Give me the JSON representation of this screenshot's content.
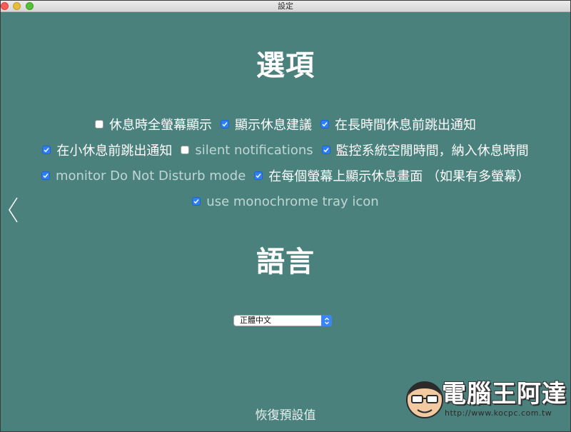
{
  "window": {
    "title": "設定",
    "background_color": "#4a817d"
  },
  "options_section": {
    "title": "選項",
    "rows": [
      [
        {
          "label": "休息時全螢幕顯示",
          "checked": false
        },
        {
          "label": "顯示休息建議",
          "checked": true
        },
        {
          "label": "在長時間休息前跳出通知",
          "checked": true
        }
      ],
      [
        {
          "label": "在小休息前跳出通知",
          "checked": true
        },
        {
          "label": "silent notifications",
          "checked": false
        },
        {
          "label": "監控系統空閒時間，納入休息時間",
          "checked": true
        }
      ],
      [
        {
          "label": "monitor Do Not Disturb mode",
          "checked": true
        },
        {
          "label": "在每個螢幕上顯示休息畫面 （如果有多螢幕）",
          "checked": true
        }
      ],
      [
        {
          "label": "use monochrome tray icon",
          "checked": true
        }
      ]
    ]
  },
  "language_section": {
    "title": "語言",
    "selected_language": "正體中文"
  },
  "reset_label": "恢復預設值",
  "navigation": {
    "back_icon": "chevron-left-icon"
  },
  "watermark": {
    "brand_text": "電腦王阿達",
    "url_text": "http://www.kocpc.com.tw"
  },
  "colors": {
    "checkbox_checked": "#2f7ff2",
    "select_stepper": "#3b85f5"
  }
}
